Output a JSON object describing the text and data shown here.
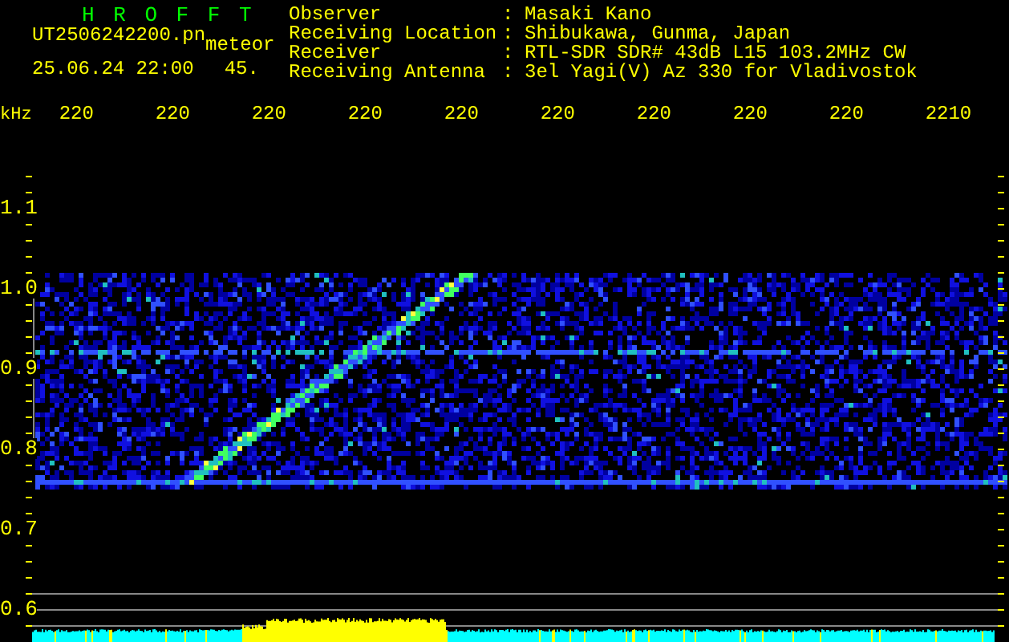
{
  "header": {
    "title": "H R O F F T",
    "file": "UT2506242200.pn",
    "event": "meteor",
    "datetime": "25.06.24 22:00",
    "count": "45."
  },
  "info": [
    {
      "label": "Observer",
      "separator": ":",
      "value": "Masaki Kano"
    },
    {
      "label": "Receiving Location",
      "separator": ":",
      "value": "Shibukawa, Gunma, Japan"
    },
    {
      "label": "Receiver",
      "separator": ":",
      "value": "RTL-SDR SDR# 43dB L15 103.2MHz CW"
    },
    {
      "label": "Receiving Antenna",
      "separator": ":",
      "value": "3el Yagi(V) Az 330 for Vladivostok"
    }
  ],
  "axis": {
    "unit": "kHz",
    "x_labels": [
      "220",
      "220",
      "220",
      "220",
      "220",
      "220",
      "220",
      "220",
      "220",
      "2210"
    ],
    "y_labels": [
      "1.1",
      "1.0",
      "0.9",
      "0.8",
      "0.7",
      "0.6"
    ]
  }
}
